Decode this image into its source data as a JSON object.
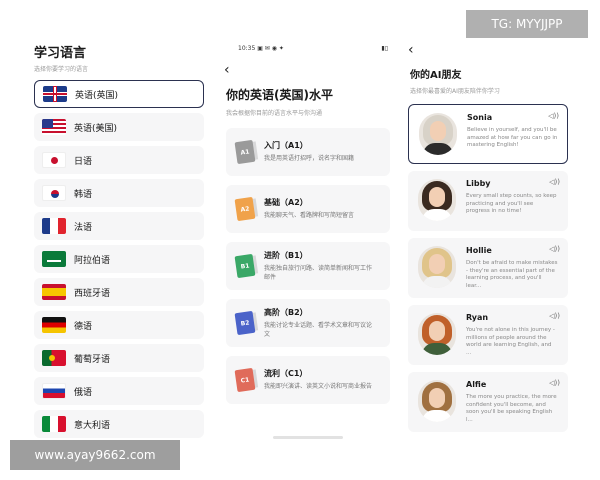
{
  "watermarks": {
    "top": "TG: MYYJJPP",
    "bottom": "www.ayay9662.com"
  },
  "screen1": {
    "title": "学习语言",
    "subtitle": "选择你要学习的语言",
    "languages": [
      {
        "label": "英语(英国)",
        "flag": "uk",
        "selected": true
      },
      {
        "label": "英语(美国)",
        "flag": "us"
      },
      {
        "label": "日语",
        "flag": "jp"
      },
      {
        "label": "韩语",
        "flag": "kr"
      },
      {
        "label": "法语",
        "flag": "fr"
      },
      {
        "label": "阿拉伯语",
        "flag": "sa"
      },
      {
        "label": "西班牙语",
        "flag": "es"
      },
      {
        "label": "德语",
        "flag": "de"
      },
      {
        "label": "葡萄牙语",
        "flag": "pt"
      },
      {
        "label": "俄语",
        "flag": "ru"
      },
      {
        "label": "意大利语",
        "flag": "it"
      }
    ]
  },
  "screen2": {
    "status": {
      "time": "10:35",
      "icons": "▣ ✉ ◉ ✦",
      "battery": "▮▯"
    },
    "back_icon": "‹",
    "title": "你的英语(英国)水平",
    "subtitle": "我会根据你目前的语言水平与你沟通",
    "levels": [
      {
        "badge": "A1",
        "name": "入门（A1）",
        "desc": "我是用英语打招呼，说名字和国籍",
        "color": "#9a9a9a"
      },
      {
        "badge": "A2",
        "name": "基础（A2）",
        "desc": "我能聊天气、看路牌和写简短留言",
        "color": "#f0a24a"
      },
      {
        "badge": "B1",
        "name": "进阶（B1）",
        "desc": "我能独自旅行问路、读简单新闻和写工作邮件",
        "color": "#3aa867"
      },
      {
        "badge": "B2",
        "name": "高阶（B2）",
        "desc": "我能讨论专业话题、看学术文章和写议论文",
        "color": "#4b63c9"
      },
      {
        "badge": "C1",
        "name": "流利（C1）",
        "desc": "我能即兴演讲、读英文小说和写商业报告",
        "color": "#e06b5a"
      }
    ]
  },
  "screen3": {
    "back_icon": "‹",
    "title": "你的AI朋友",
    "subtitle": "选择你最喜爱的AI朋友陪伴你学习",
    "speaker_icon": "◁))",
    "friends": [
      {
        "name": "Sonia",
        "msg": "Believe in yourself, and you'll be amazed at how far you can go in mastering English!",
        "selected": true,
        "hair": "#d8d2c8",
        "shirt": "#2b2b2b"
      },
      {
        "name": "Libby",
        "msg": "Every small step counts, so keep practicing and you'll see progress in no time!",
        "hair": "#3a2a20",
        "shirt": "#ffffff"
      },
      {
        "name": "Hollie",
        "msg": "Don't be afraid to make mistakes - they're an essential part of the learning process, and you'll lear...",
        "hair": "#e0c48a",
        "shirt": "#f2f2f2"
      },
      {
        "name": "Ryan",
        "msg": "You're not alone in this journey - millions of people around the world are learning English, and ...",
        "hair": "#c0602a",
        "shirt": "#3f5f3a"
      },
      {
        "name": "Alfie",
        "msg": "The more you practice, the more confident you'll become, and soon you'll be speaking English l...",
        "hair": "#a07040",
        "shirt": "#ffffff"
      }
    ]
  }
}
